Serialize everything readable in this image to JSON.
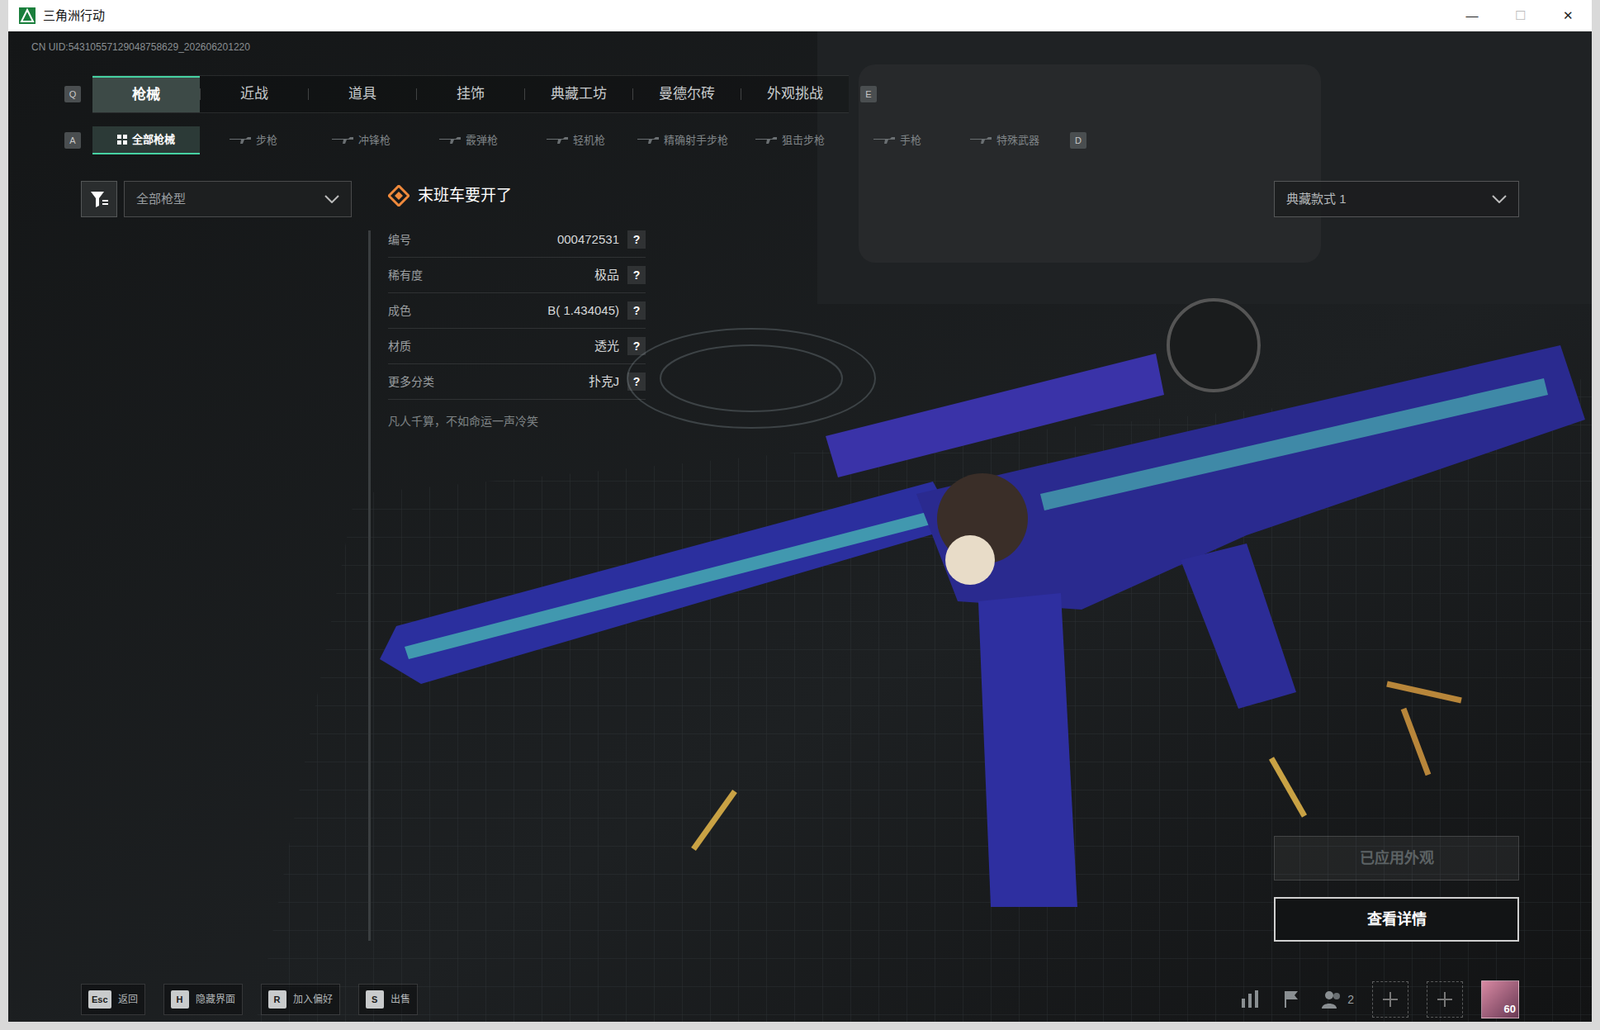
{
  "window": {
    "title": "三角洲行动",
    "controls": [
      "—",
      "☐",
      "✕"
    ]
  },
  "uid": "CN UID:54310557129048758629_202606201220",
  "main_tabs": {
    "prev_key": "Q",
    "next_key": "E",
    "items": [
      {
        "label": "枪械",
        "selected": true
      },
      {
        "label": "近战",
        "selected": false
      },
      {
        "label": "道具",
        "selected": false
      },
      {
        "label": "挂饰",
        "selected": false
      },
      {
        "label": "典藏工坊",
        "selected": false
      },
      {
        "label": "曼德尔砖",
        "selected": false
      },
      {
        "label": "外观挑战",
        "selected": false
      }
    ]
  },
  "sub_tabs": {
    "prev_key": "A",
    "next_key": "D",
    "items": [
      {
        "label": "全部枪械",
        "selected": true
      },
      {
        "label": "步枪",
        "selected": false
      },
      {
        "label": "冲锋枪",
        "selected": false
      },
      {
        "label": "霰弹枪",
        "selected": false
      },
      {
        "label": "轻机枪",
        "selected": false
      },
      {
        "label": "精确射手步枪",
        "selected": false
      },
      {
        "label": "狙击步枪",
        "selected": false
      },
      {
        "label": "手枪",
        "selected": false
      },
      {
        "label": "特殊武器",
        "selected": false
      }
    ]
  },
  "filter": {
    "value": "全部枪型"
  },
  "weapons": [
    {
      "equipped": true,
      "selected": false,
      "badge": false,
      "color": "#8a7f72"
    },
    {
      "equipped": true,
      "selected": true,
      "badge": true,
      "color": "#5a56d8"
    },
    {
      "equipped": false,
      "selected": false,
      "badge": false,
      "color": "#7d7a74"
    },
    {
      "equipped": true,
      "selected": false,
      "badge": false,
      "color": "#6f86a8"
    },
    {
      "equipped": true,
      "selected": false,
      "badge": true,
      "color": "#7fb8a6"
    },
    {
      "equipped": true,
      "selected": false,
      "badge": false,
      "color": "#c9a45a"
    },
    {
      "equipped": true,
      "selected": false,
      "badge": false,
      "color": "#c8c8c8"
    },
    {
      "equipped": false,
      "selected": false,
      "badge": false,
      "color": "#e3a1ad"
    },
    {
      "equipped": true,
      "selected": false,
      "badge": false,
      "color": "#e07a92"
    },
    {
      "equipped": true,
      "selected": false,
      "badge": false,
      "color": "#e69bb0"
    },
    {
      "equipped": false,
      "selected": false,
      "badge": false,
      "color": "#8c6b4a"
    },
    {
      "equipped": false,
      "selected": false,
      "badge": false,
      "color": "#c8303c"
    },
    {
      "equipped": true,
      "selected": false,
      "badge": false,
      "color": "#d23a46"
    },
    {
      "equipped": false,
      "selected": false,
      "badge": false,
      "color": "#d9d2d0"
    },
    {
      "equipped": true,
      "selected": false,
      "badge": false,
      "color": "#b07a55"
    },
    {
      "equipped": false,
      "selected": false,
      "badge": false,
      "color": "#c9b29a"
    },
    {
      "equipped": true,
      "selected": false,
      "badge": false,
      "color": "#d39a4a"
    },
    {
      "equipped": true,
      "selected": false,
      "badge": false,
      "color": "#3d4f72"
    },
    {
      "equipped": true,
      "selected": false,
      "badge": false,
      "color": "#d8b04a"
    },
    {
      "equipped": false,
      "selected": false,
      "badge": false,
      "color": "#bfae95"
    },
    {
      "equipped": true,
      "selected": false,
      "badge": false,
      "color": "#a04a52"
    },
    {
      "equipped": true,
      "selected": false,
      "badge": false,
      "color": "#c23a4a"
    },
    {
      "equipped": true,
      "selected": false,
      "badge": false,
      "color": "#cfcfcf"
    },
    {
      "equipped": true,
      "selected": false,
      "badge": false,
      "color": "#e0e0e0"
    }
  ],
  "item": {
    "title": "末班车要开了",
    "fields": [
      {
        "label": "编号",
        "value": "000472531",
        "help": "?"
      },
      {
        "label": "稀有度",
        "value": "极品",
        "help": "?"
      },
      {
        "label": "成色",
        "value": "B( 1.434045)",
        "help": "?"
      },
      {
        "label": "材质",
        "value": "透光",
        "help": "?"
      },
      {
        "label": "更多分类",
        "value": "扑克J",
        "help": "?"
      }
    ],
    "description": "凡人千算，不如命运一声冷笑"
  },
  "style_select": {
    "value": "典藏款式 1"
  },
  "buttons": [
    {
      "label": "已应用外观",
      "disabled": true
    },
    {
      "label": "查看详情",
      "disabled": false
    }
  ],
  "hints": [
    {
      "key": "Esc",
      "label": "返回"
    },
    {
      "key": "H",
      "label": "隐藏界面"
    },
    {
      "key": "R",
      "label": "加入偏好"
    },
    {
      "key": "S",
      "label": "出售"
    }
  ],
  "footer": {
    "team_count": "2",
    "level": "60"
  }
}
